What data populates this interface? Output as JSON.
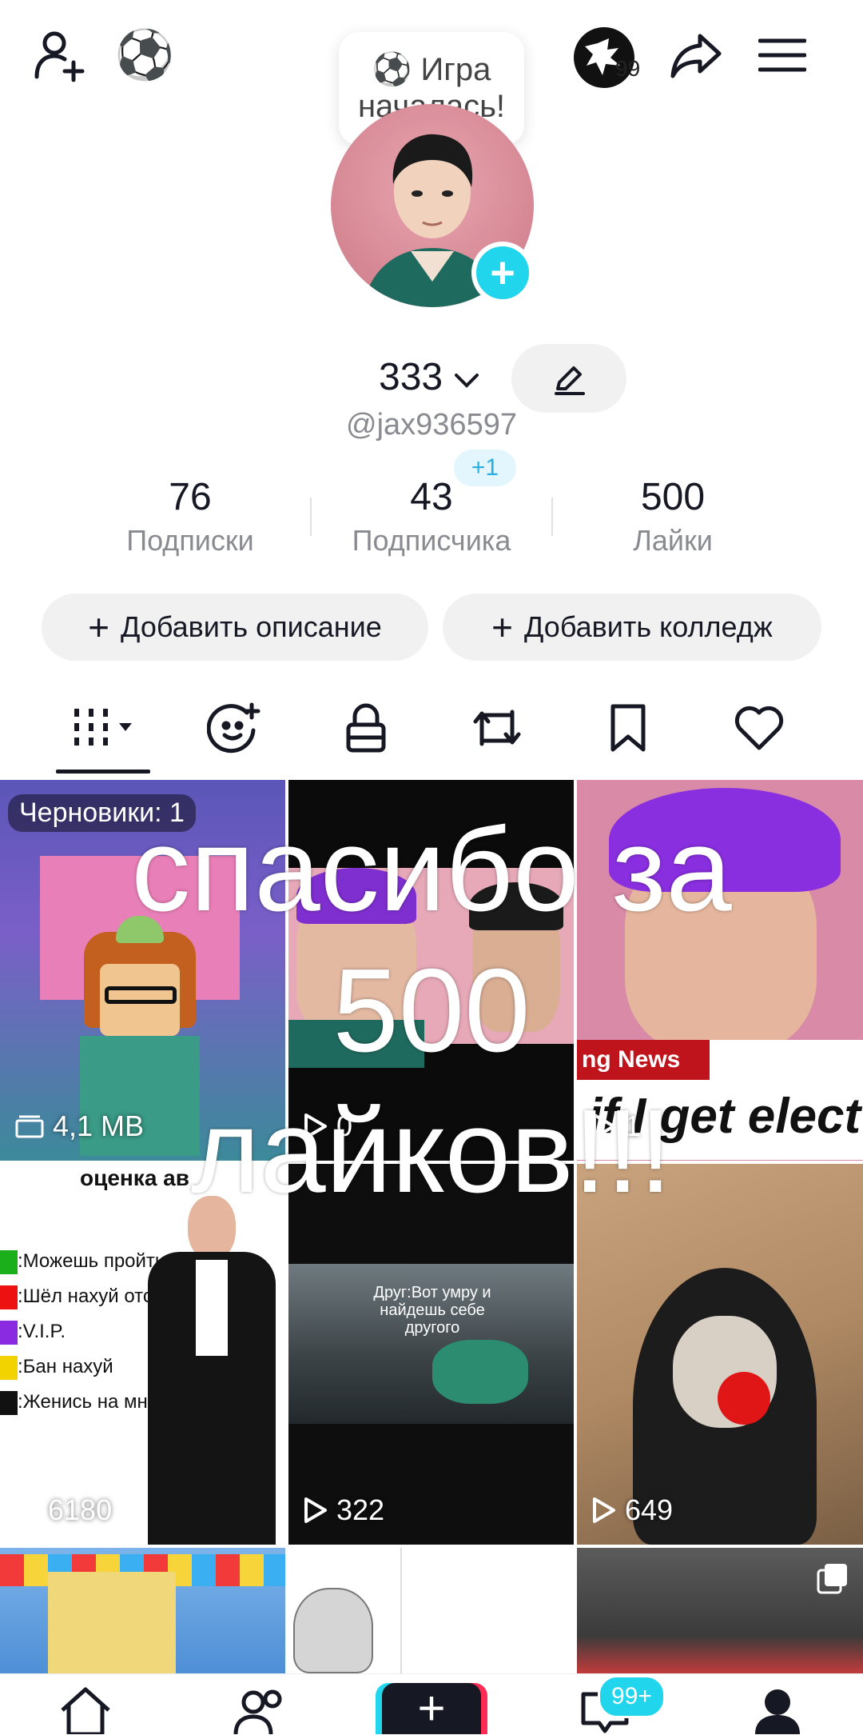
{
  "topbar": {
    "game_bubble_emoji": "⚽",
    "game_bubble_text_1": "Игра",
    "game_bubble_text_2": "началась!",
    "notif_badge": "99"
  },
  "profile": {
    "name": "333",
    "handle": "@jax936597",
    "new_followers_badge": "+1",
    "stats": [
      {
        "value": "76",
        "label": "Подписки"
      },
      {
        "value": "43",
        "label": "Подписчика"
      },
      {
        "value": "500",
        "label": "Лайки"
      }
    ],
    "add_description": "Добавить описание",
    "add_college": "Добавить колледж"
  },
  "grid": {
    "drafts_label": "Черновики: 1",
    "drafts_size": "4,1 MB",
    "cells": [
      {
        "count": "0",
        "caption": ""
      },
      {
        "count": "1",
        "caption": "ng News",
        "headline": "if I get elect"
      },
      {
        "count": "6180",
        "title": "оценка ав",
        "list": [
          ":Можешь пройти",
          ":Шёл нахуй отсюда",
          ":V.I.P.",
          ":Бан нахуй",
          ":Женись на мне"
        ]
      },
      {
        "count": "322",
        "caption": "Друг:Вот умру и найдешь себе другого"
      },
      {
        "count": "649"
      }
    ],
    "overlay_text_1": "спасибо за",
    "overlay_text_2": "500",
    "overlay_text_3": "лайков!!!"
  },
  "bottom_nav": {
    "inbox_badge": "99+"
  },
  "colors": {
    "accent_cyan": "#20d5ec",
    "accent_red": "#fe2c55",
    "text_primary": "#161823",
    "text_secondary": "#8a8b91"
  },
  "icons": [
    "add-friend-icon",
    "soccer-ball-icon",
    "share-icon",
    "menu-icon",
    "edit-icon",
    "grid-icon",
    "smile-icon",
    "lock-icon",
    "repost-icon",
    "bookmark-icon",
    "heart-icon",
    "home-icon",
    "friends-icon",
    "plus-icon",
    "inbox-icon",
    "profile-icon"
  ]
}
